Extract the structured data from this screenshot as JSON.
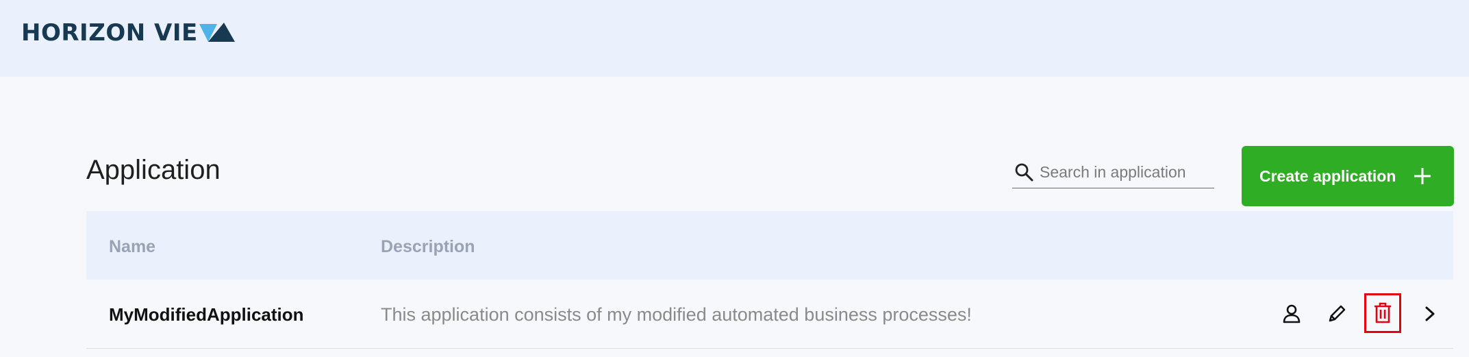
{
  "header": {
    "logo_text": "HORIZON VIE"
  },
  "page": {
    "title": "Application"
  },
  "search": {
    "placeholder": "Search in application",
    "value": ""
  },
  "toolbar": {
    "create_label": "Create application"
  },
  "table": {
    "columns": [
      "Name",
      "Description"
    ],
    "rows": [
      {
        "name": "MyModifiedApplication",
        "description": "This application consists of my modified automated business processes!"
      }
    ]
  },
  "icons": {
    "search": "search-icon",
    "plus": "plus-icon",
    "user": "user-icon",
    "edit": "pencil-icon",
    "delete": "trash-icon",
    "open": "chevron-right-icon"
  },
  "colors": {
    "header_bg": "#eaf1fd",
    "page_bg": "#f7f8fc",
    "brand_dark": "#173a52",
    "brand_light": "#4fb3e8",
    "primary_button": "#2fad24",
    "delete_highlight": "#e3000f"
  }
}
